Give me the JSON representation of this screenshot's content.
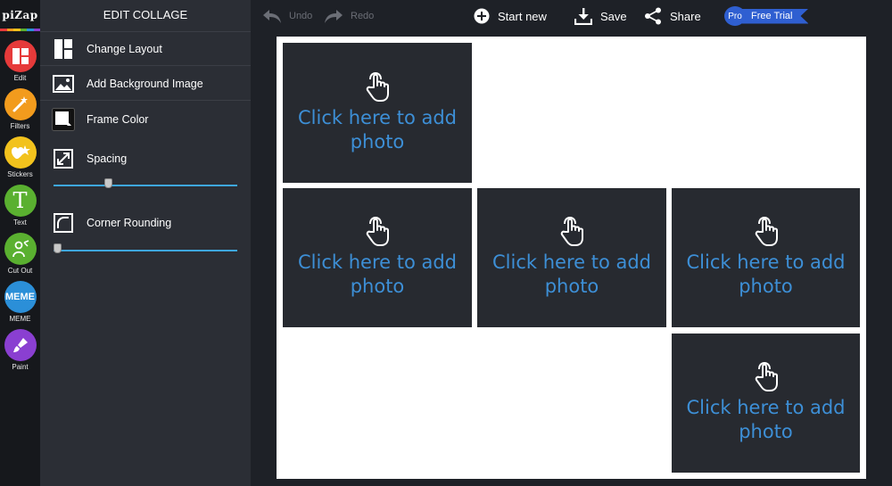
{
  "app": {
    "logo": "piZap",
    "brand_colors": [
      "#e63a3a",
      "#f29b1d",
      "#f2c21d",
      "#5ab030",
      "#2b8fd8",
      "#8a3fd1"
    ]
  },
  "rail": {
    "tools": [
      {
        "label": "Edit",
        "icon": "layout-icon",
        "color": "#e63a3a"
      },
      {
        "label": "Filters",
        "icon": "magic-wand-icon",
        "color": "#f29b1d"
      },
      {
        "label": "Stickers",
        "icon": "stickers-icon",
        "color": "#f2c21d"
      },
      {
        "label": "Text",
        "icon": "text-t-icon",
        "color": "#5ab030"
      },
      {
        "label": "Cut Out",
        "icon": "cutout-icon",
        "color": "#5ab030"
      },
      {
        "label": "MEME",
        "icon": "meme-icon",
        "color": "#2b8fd8"
      },
      {
        "label": "Paint",
        "icon": "brush-icon",
        "color": "#8a3fd1"
      }
    ],
    "meme_badge": "MEME",
    "text_badge": "T"
  },
  "panel": {
    "title": "EDIT COLLAGE",
    "change_layout": "Change Layout",
    "add_background": "Add Background Image",
    "frame_color": "Frame Color",
    "spacing": "Spacing",
    "spacing_value": 0.29,
    "corner_rounding": "Corner Rounding",
    "corner_value": 0.0
  },
  "toolbar": {
    "undo": "Undo",
    "redo": "Redo",
    "start_new": "Start new",
    "save": "Save",
    "share": "Share",
    "pro_badge": "Pro",
    "free_trial": "Free Trial"
  },
  "collage": {
    "placeholder": "Click here to add photo",
    "cells": 5,
    "accent": "#3d8fd6",
    "cell_bg": "#272a30"
  }
}
